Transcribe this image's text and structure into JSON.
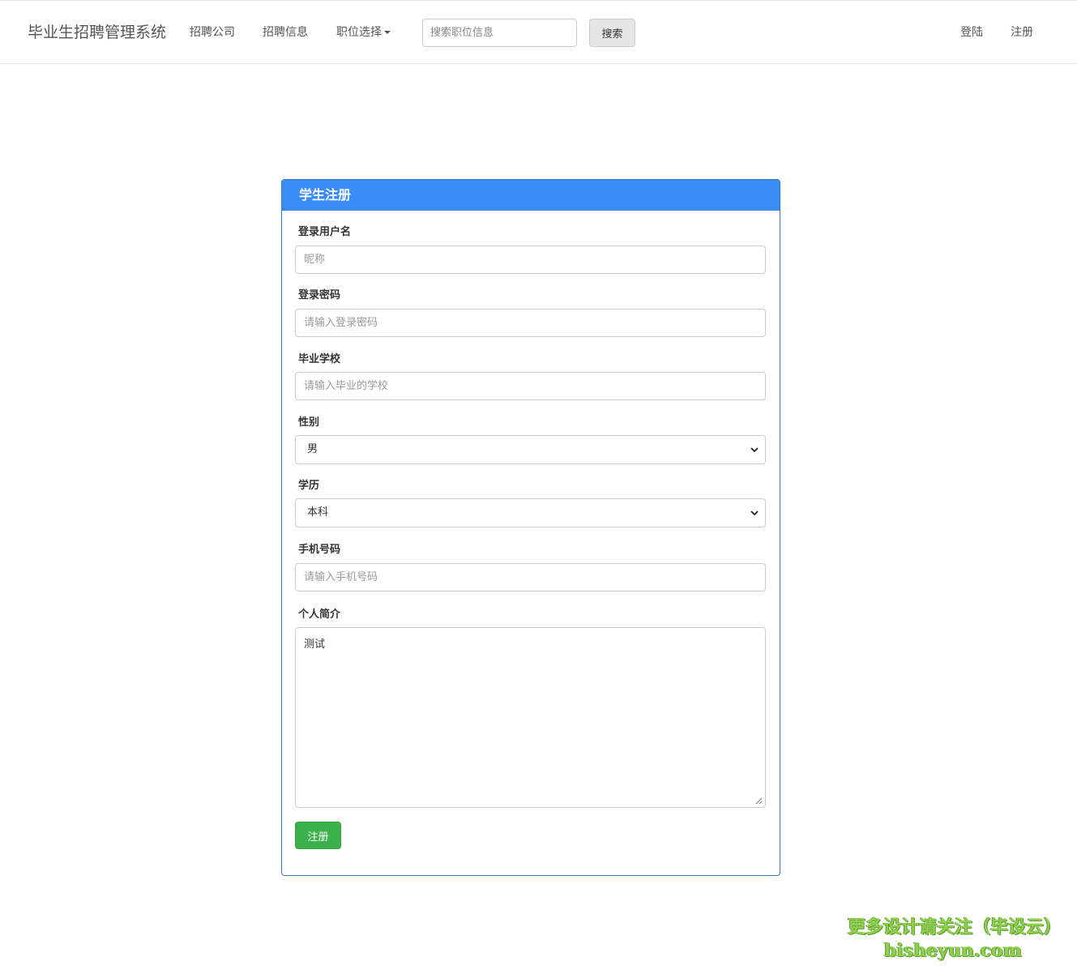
{
  "navbar": {
    "brand": "毕业生招聘管理系统",
    "links": [
      "招聘公司",
      "招聘信息"
    ],
    "dropdown_label": "职位选择",
    "search": {
      "placeholder": "搜索职位信息",
      "button_label": "搜索"
    },
    "login_label": "登陆",
    "register_label": "注册"
  },
  "form": {
    "title": "学生注册",
    "username": {
      "label": "登录用户名",
      "placeholder": "昵称"
    },
    "password": {
      "label": "登录密码",
      "placeholder": "请输入登录密码"
    },
    "school": {
      "label": "毕业学校",
      "placeholder": "请输入毕业的学校"
    },
    "gender": {
      "label": "性别",
      "selected": "男"
    },
    "education": {
      "label": "学历",
      "selected": "本科"
    },
    "phone": {
      "label": "手机号码",
      "placeholder": "请输入手机号码"
    },
    "bio": {
      "label": "个人简介",
      "value": "测试"
    },
    "submit_label": "注册"
  },
  "watermark": {
    "line1": "更多设计请关注（毕设云）",
    "line2": "bisheyun.com"
  },
  "colors": {
    "panel_heading": "#3b8cf5",
    "panel_border": "#337ab7",
    "submit_button": "#3cb04b",
    "watermark": "#8fd14f"
  }
}
